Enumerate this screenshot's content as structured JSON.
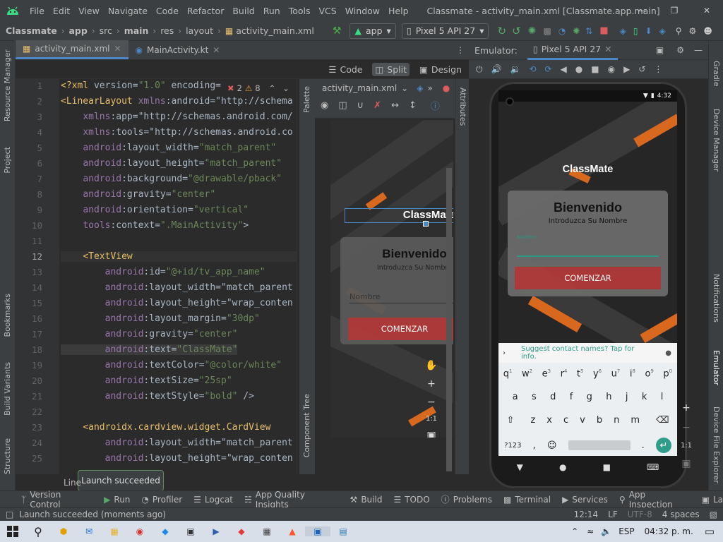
{
  "menubar": {
    "items": [
      "File",
      "Edit",
      "View",
      "Navigate",
      "Code",
      "Refactor",
      "Build",
      "Run",
      "Tools",
      "VCS",
      "Window",
      "Help"
    ],
    "title": "Classmate - activity_main.xml [Classmate.app.main]"
  },
  "breadcrumb": [
    "Classmate",
    "app",
    "src",
    "main",
    "res",
    "layout",
    "activity_main.xml"
  ],
  "toolbar": {
    "run_config": "app",
    "device": "Pixel 5 API 27"
  },
  "editor_tabs": [
    {
      "label": "activity_main.xml"
    },
    {
      "label": "MainActivity.kt"
    }
  ],
  "view_modes": {
    "code": "Code",
    "split": "Split",
    "design": "Design"
  },
  "inspection": {
    "errors": "2",
    "warnings": "8"
  },
  "line_numbers": [
    "1",
    "2",
    "3",
    "4",
    "5",
    "6",
    "7",
    "8",
    "9",
    "10",
    "11",
    "12",
    "13",
    "14",
    "15",
    "16",
    "17",
    "18",
    "19",
    "20",
    "21",
    "22",
    "23",
    "24",
    "25"
  ],
  "code_lines": [
    "<?xml version=\"1.0\" encoding=",
    "<LinearLayout xmlns:android=\"http://schema",
    "    xmlns:app=\"http://schemas.android.com/",
    "    xmlns:tools=\"http://schemas.android.co",
    "    android:layout_width=\"match_parent\"",
    "    android:layout_height=\"match_parent\"",
    "    android:background=\"@drawable/pback\"",
    "    android:gravity=\"center\"",
    "    android:orientation=\"vertical\"",
    "    tools:context=\".MainActivity\">",
    "",
    "    <TextView",
    "        android:id=\"@+id/tv_app_name\"",
    "        android:layout_width=\"match_parent",
    "        android:layout_height=\"wrap_conten",
    "        android:layout_margin=\"30dp\"",
    "        android:gravity=\"center\"",
    "        android:text=\"ClassMate\"",
    "        android:textColor=\"@color/white\"",
    "        android:textSize=\"25sp\"",
    "        android:textStyle=\"bold\" />",
    "",
    "    <androidx.cardview.widget.CardView",
    "        android:layout_width=\"match_parent",
    "        android:layout_height=\"wrap_conten"
  ],
  "design_preview": {
    "file": "activity_main.xml",
    "app_name": "ClassMate",
    "welcome": "Bienvenido",
    "subtitle": "Introduzca Su Nombre",
    "hint": "Nombre",
    "button": "COMENZAR",
    "zoom": "1:1"
  },
  "side_panels": {
    "left": [
      "Resource Manager",
      "Project",
      "Bookmarks",
      "Build Variants",
      "Structure"
    ],
    "right": [
      "Gradle",
      "Device Manager",
      "Notifications",
      "Emulator",
      "Device File Explorer"
    ],
    "palette": "Palette",
    "component_tree": "Component Tree",
    "attributes": "Attributes"
  },
  "emulator": {
    "label": "Emulator:",
    "device_tab": "Pixel 5 API 27",
    "status_time": "4:32",
    "app_name": "ClassMate",
    "welcome": "Bienvenido",
    "subtitle": "Introduzca Su Nombre",
    "field_label": "Nombre",
    "button": "COMENZAR",
    "suggestion": "Suggest contact names? Tap for info.",
    "keys_row1": [
      "q",
      "w",
      "e",
      "r",
      "t",
      "y",
      "u",
      "i",
      "o",
      "p"
    ],
    "keys_row1_hints": [
      "1",
      "2",
      "3",
      "4",
      "5",
      "6",
      "7",
      "8",
      "9",
      "0"
    ],
    "keys_row2": [
      "a",
      "s",
      "d",
      "f",
      "g",
      "h",
      "j",
      "k",
      "l"
    ],
    "keys_row3": [
      "z",
      "x",
      "c",
      "v",
      "b",
      "n",
      "m"
    ],
    "key_symbols": "?123",
    "key_comma": ",",
    "key_period": ".",
    "zoom": "1:1"
  },
  "bottom_tools": [
    "Version Control",
    "Run",
    "Profiler",
    "Logcat",
    "App Quality Insights",
    "Build",
    "TODO",
    "Problems",
    "Terminal",
    "Services",
    "App Inspection",
    "La"
  ],
  "toast": "Launch succeeded",
  "partial_tab": "Line",
  "status": {
    "message": "Launch succeeded (moments ago)",
    "position": "12:14",
    "line_sep": "LF",
    "encoding": "UTF-8",
    "indent": "4 spaces"
  },
  "taskbar": {
    "lang": "ESP",
    "time": "04:32 p. m."
  },
  "colors": {
    "accent": "#4a88c7",
    "button_red": "#b23a3a",
    "orange": "#d9681f",
    "bg": "#2b2b2b"
  }
}
